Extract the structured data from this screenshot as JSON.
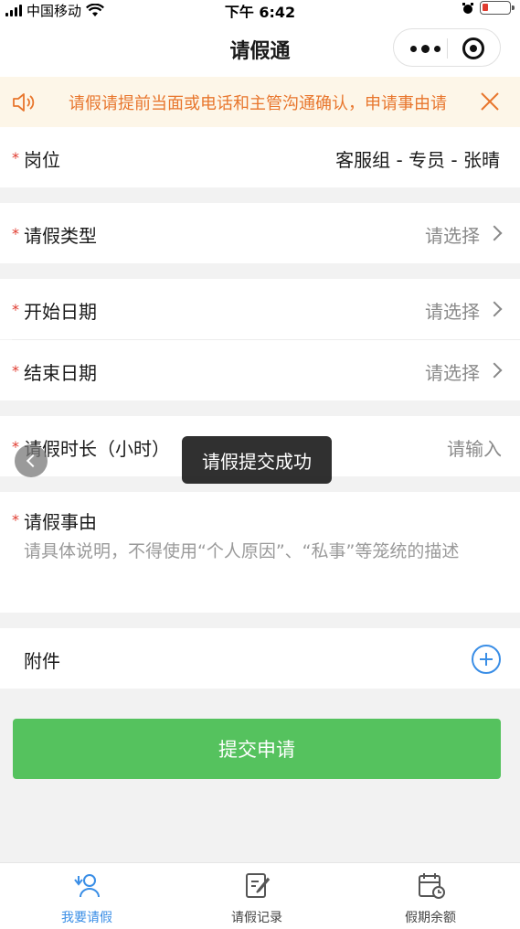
{
  "status_bar": {
    "carrier": "中国移动",
    "time": "下午 6:42"
  },
  "nav": {
    "title": "请假通"
  },
  "notice": {
    "text": "请假请提前当面或电话和主管沟通确认，申请事由请"
  },
  "form": {
    "position": {
      "label": "岗位",
      "value": "客服组 - 专员 - 张晴"
    },
    "leave_type": {
      "label": "请假类型",
      "placeholder": "请选择"
    },
    "start_date": {
      "label": "开始日期",
      "placeholder": "请选择"
    },
    "end_date": {
      "label": "结束日期",
      "placeholder": "请选择"
    },
    "duration": {
      "label": "请假时长（小时）",
      "placeholder": "请输入"
    },
    "reason": {
      "label": "请假事由",
      "placeholder": "请具体说明，不得使用“个人原因”、“私事”等笼统的描述"
    },
    "attachment": {
      "label": "附件"
    }
  },
  "submit_label": "提交申请",
  "toast": "请假提交成功",
  "tabs": [
    {
      "label": "我要请假",
      "icon": "user-leave-icon",
      "active": true
    },
    {
      "label": "请假记录",
      "icon": "edit-record-icon",
      "active": false
    },
    {
      "label": "假期余额",
      "icon": "calendar-clock-icon",
      "active": false
    }
  ],
  "colors": {
    "accent": "#3a8ee6",
    "submit": "#55c25e",
    "notice_text": "#e8762d",
    "notice_bg": "#fdf6e8",
    "required": "#e03b2f"
  }
}
